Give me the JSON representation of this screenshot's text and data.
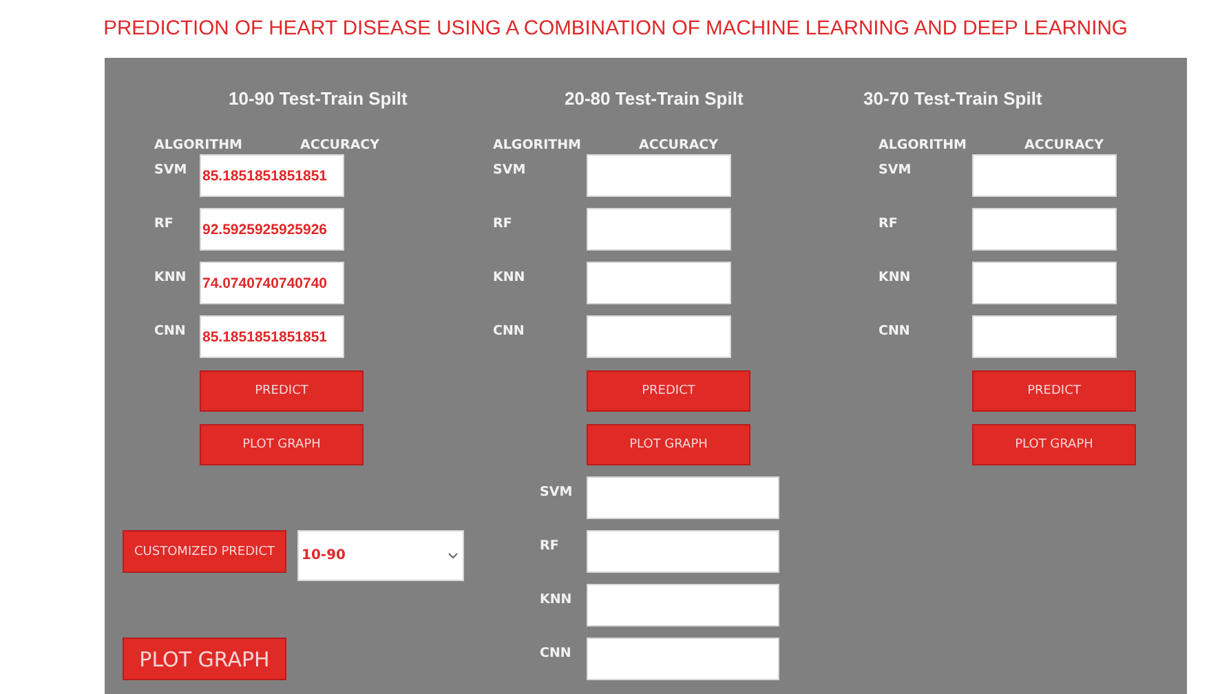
{
  "title": "PREDICTION OF HEART DISEASE USING A COMBINATION OF MACHINE LEARNING AND DEEP LEARNING",
  "splits": [
    {
      "heading": "10-90 Test-Train Spilt",
      "algorithm_header": "ALGORITHM",
      "accuracy_header": "ACCURACY",
      "rows": [
        {
          "algorithm": "SVM",
          "accuracy": "85.1851851851851"
        },
        {
          "algorithm": "RF",
          "accuracy": "92.5925925925926"
        },
        {
          "algorithm": "KNN",
          "accuracy": "74.0740740740740"
        },
        {
          "algorithm": "CNN",
          "accuracy": "85.1851851851851"
        }
      ],
      "predict_button": "PREDICT",
      "plot_button": "PLOT GRAPH"
    },
    {
      "heading": "20-80 Test-Train Spilt",
      "algorithm_header": "ALGORITHM",
      "accuracy_header": "ACCURACY",
      "rows": [
        {
          "algorithm": "SVM"
        },
        {
          "algorithm": "RF"
        },
        {
          "algorithm": "KNN"
        },
        {
          "algorithm": "CNN"
        }
      ],
      "predict_button": "PREDICT",
      "plot_button": "PLOT GRAPH"
    },
    {
      "heading": "30-70 Test-Train Spilt",
      "algorithm_header": "ALGORITHM",
      "accuracy_header": "ACCURACY",
      "rows": [
        {
          "algorithm": "SVM"
        },
        {
          "algorithm": "RF"
        },
        {
          "algorithm": "KNN"
        },
        {
          "algorithm": "CNN"
        }
      ],
      "predict_button": "PREDICT",
      "plot_button": "PLOT GRAPH"
    }
  ],
  "custom": {
    "predict_button": "CUSTOMIZED PREDICT",
    "split_select": {
      "value": "10-90"
    },
    "plot_button": "PLOT GRAPH",
    "rows": [
      {
        "algorithm": "SVM"
      },
      {
        "algorithm": "RF"
      },
      {
        "algorithm": "KNN"
      },
      {
        "algorithm": "CNN"
      }
    ]
  }
}
